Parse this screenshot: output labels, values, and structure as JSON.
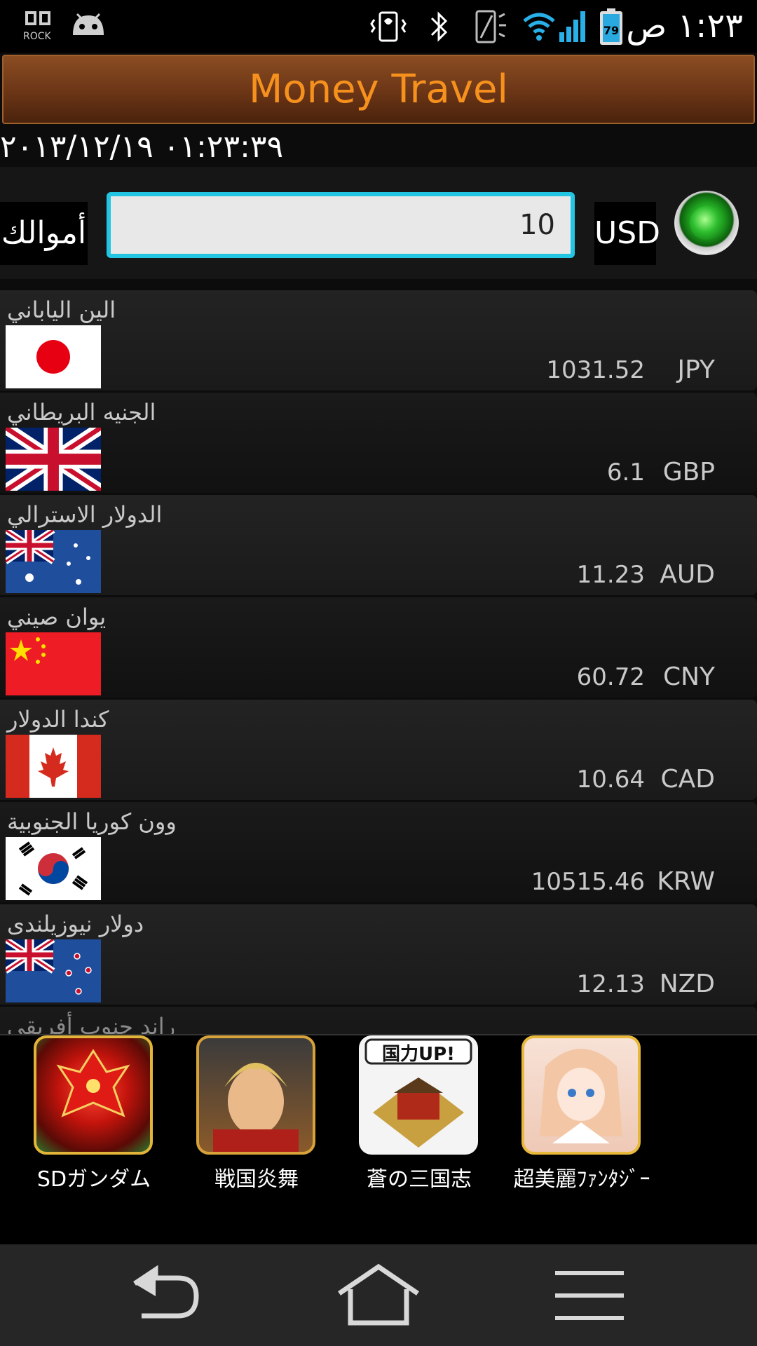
{
  "status_bar": {
    "time": "١:٢٣ ص",
    "battery_level": "79",
    "rock_label": "ROCK",
    "icons": [
      "dolby-rock-icon",
      "android-icon",
      "vibrate-icon",
      "bluetooth-icon",
      "rotation-icon",
      "wifi-icon",
      "signal-icon",
      "battery-icon"
    ]
  },
  "app": {
    "title": "Money Travel",
    "datetime": "٠١:٢٣:٣٩ ٢٠١٣/١٢/١٩"
  },
  "converter": {
    "funds_label": "أموالك",
    "amount_value": "10",
    "currency_code": "USD"
  },
  "currencies": [
    {
      "name": "الين الياباني",
      "value": "1031.52",
      "code": "JPY"
    },
    {
      "name": "الجنيه البريطاني",
      "value": "6.1",
      "code": "GBP"
    },
    {
      "name": "الدولار الاسترالي",
      "value": "11.23",
      "code": "AUD"
    },
    {
      "name": "يوان صيني",
      "value": "60.72",
      "code": "CNY"
    },
    {
      "name": "كندا الدولار",
      "value": "10.64",
      "code": "CAD"
    },
    {
      "name": "وون كوريا الجنوبية",
      "value": "10515.46",
      "code": "KRW"
    },
    {
      "name": "دولار نيوزيلندى",
      "value": "12.13",
      "code": "NZD"
    },
    {
      "name": "راند جنوب أفريقي",
      "value": "",
      "code": ""
    }
  ],
  "ads": [
    {
      "label": "SDガンダム"
    },
    {
      "label": "戦国炎舞"
    },
    {
      "label": "蒼の三国志"
    },
    {
      "label": "超美麗ﾌｧﾝﾀｼﾞｰ"
    }
  ],
  "ad_badge": "国力UP!",
  "colors": {
    "title_text": "#f7911e",
    "input_border": "#22c6e3",
    "go_button": "#2fbf2f"
  }
}
